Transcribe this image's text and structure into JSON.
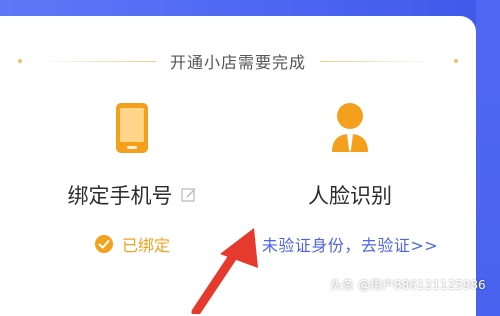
{
  "heading": {
    "text": "开通小店需要完成"
  },
  "tasks": [
    {
      "title": "绑定手机号",
      "status": "已绑定",
      "icon": "phone-icon"
    },
    {
      "title": "人脸识别",
      "status": "未验证身份，去验证>>",
      "icon": "person-icon"
    }
  ],
  "watermark": {
    "site": "头条",
    "user": "@用户886121125986"
  },
  "colors": {
    "accent_orange": "#f3a21d",
    "link_blue": "#4e66e6",
    "background_blue": "#4a62f0",
    "arrow_red": "#e53a2e"
  }
}
